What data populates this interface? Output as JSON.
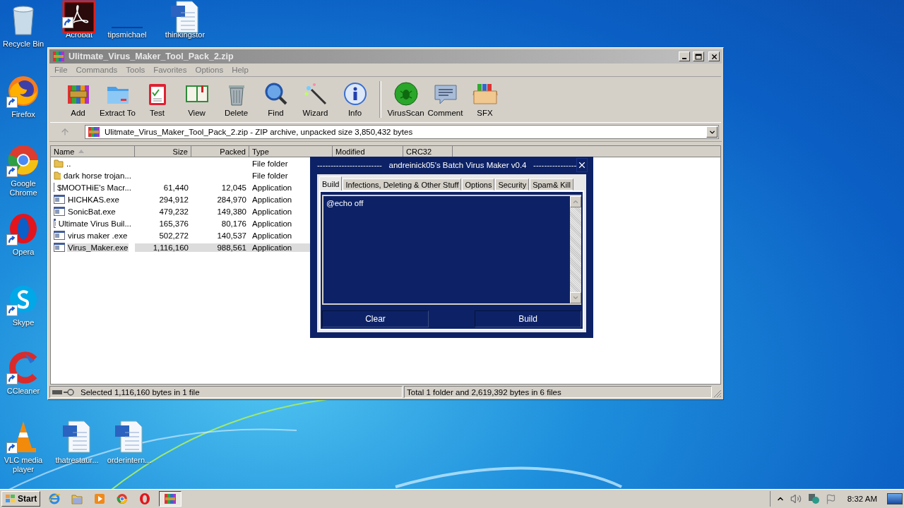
{
  "desktop": {
    "icons": [
      {
        "label": "Recycle Bin",
        "kind": "recycle",
        "shortcut": false
      },
      {
        "label": "Acrobat",
        "kind": "acrobat",
        "shortcut": true
      },
      {
        "label": "tipsmichael",
        "kind": "blank",
        "shortcut": false
      },
      {
        "label": "thinkingstor",
        "kind": "word",
        "shortcut": false
      },
      {
        "label": "Firefox",
        "kind": "firefox",
        "shortcut": true
      },
      {
        "label": "Google Chrome",
        "kind": "chrome",
        "shortcut": true
      },
      {
        "label": "Opera",
        "kind": "opera",
        "shortcut": true
      },
      {
        "label": "Skype",
        "kind": "skype",
        "shortcut": true
      },
      {
        "label": "CCleaner",
        "kind": "ccleaner",
        "shortcut": true
      },
      {
        "label": "VLC media player",
        "kind": "vlc",
        "shortcut": true
      },
      {
        "label": "thatrestaur...",
        "kind": "word",
        "shortcut": false
      },
      {
        "label": "orderintern...",
        "kind": "word",
        "shortcut": false
      }
    ]
  },
  "window": {
    "title": "Ulitmate_Virus_Maker_Tool_Pack_2.zip",
    "menu": [
      "File",
      "Commands",
      "Tools",
      "Favorites",
      "Options",
      "Help"
    ],
    "toolbar": [
      {
        "label": "Add",
        "kind": "add"
      },
      {
        "label": "Extract To",
        "kind": "extract"
      },
      {
        "label": "Test",
        "kind": "test"
      },
      {
        "label": "View",
        "kind": "view"
      },
      {
        "label": "Delete",
        "kind": "delete"
      },
      {
        "label": "Find",
        "kind": "find"
      },
      {
        "label": "Wizard",
        "kind": "wizard"
      },
      {
        "label": "Info",
        "kind": "info"
      },
      {
        "label": "VirusScan",
        "kind": "virusscan"
      },
      {
        "label": "Comment",
        "kind": "comment"
      },
      {
        "label": "SFX",
        "kind": "sfx"
      }
    ],
    "address": "Ulitmate_Virus_Maker_Tool_Pack_2.zip - ZIP archive, unpacked size 3,850,432 bytes",
    "columns": [
      "Name",
      "Size",
      "Packed",
      "Type",
      "Modified",
      "CRC32"
    ],
    "rows": [
      {
        "name": "..",
        "size": "",
        "packed": "",
        "type": "File folder",
        "kind": "folder",
        "selected": false
      },
      {
        "name": "dark horse trojan...",
        "size": "",
        "packed": "",
        "type": "File folder",
        "kind": "folder",
        "selected": false
      },
      {
        "name": "$MOOTHiE's Macr...",
        "size": "61,440",
        "packed": "12,045",
        "type": "Application",
        "kind": "app",
        "selected": false
      },
      {
        "name": "HICHKAS.exe",
        "size": "294,912",
        "packed": "284,970",
        "type": "Application",
        "kind": "app",
        "selected": false
      },
      {
        "name": "SonicBat.exe",
        "size": "479,232",
        "packed": "149,380",
        "type": "Application",
        "kind": "app",
        "selected": false
      },
      {
        "name": "Ultimate Virus Buil...",
        "size": "165,376",
        "packed": "80,176",
        "type": "Application",
        "kind": "app",
        "selected": false
      },
      {
        "name": "virus maker .exe",
        "size": "502,272",
        "packed": "140,537",
        "type": "Application",
        "kind": "app",
        "selected": false
      },
      {
        "name": "Virus_Maker.exe",
        "size": "1,116,160",
        "packed": "988,561",
        "type": "Application",
        "kind": "app",
        "selected": true
      }
    ],
    "status_left": "Selected 1,116,160 bytes in 1 file",
    "status_right": "Total 1 folder and 2,619,392 bytes in 6 files"
  },
  "dialog": {
    "title": "------------------------   andreinick05's Batch Virus Maker v0.4   ----------------",
    "tabs": [
      {
        "label": "Build",
        "selected": true
      },
      {
        "label": "Infections, Deleting & Other Stuff",
        "selected": false
      },
      {
        "label": "Options",
        "selected": false
      },
      {
        "label": "Security",
        "selected": false
      },
      {
        "label": "Spam& Kill",
        "selected": false
      }
    ],
    "script": "@echo off",
    "buttons": [
      "Clear",
      "Build"
    ]
  },
  "taskbar": {
    "start": "Start",
    "apps": [
      {
        "kind": "ie",
        "selected": false
      },
      {
        "kind": "explorer",
        "selected": false
      },
      {
        "kind": "media",
        "selected": false
      },
      {
        "kind": "chrome",
        "selected": false
      },
      {
        "kind": "opera",
        "selected": false
      },
      {
        "kind": "winrar",
        "selected": true
      }
    ],
    "time": "8:32 AM"
  }
}
